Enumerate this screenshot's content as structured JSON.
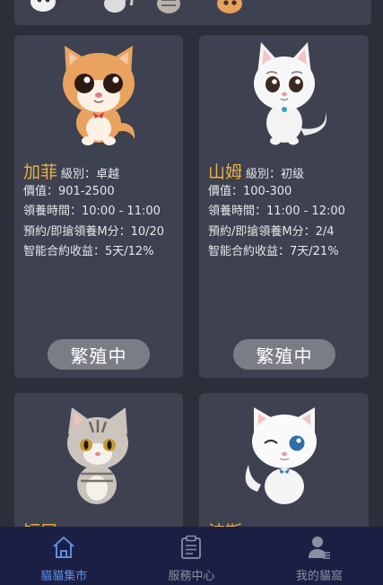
{
  "cats": [
    {
      "name": "加菲",
      "level": "級別：卓越",
      "price": "價值：901-2500",
      "adopt_time": "領養時間：10:00 - 11:00",
      "reserve": "預約/即搶領養M分：10/20",
      "contract": "智能合約收益：5天/12%",
      "status": "繁殖中"
    },
    {
      "name": "山姆",
      "level": "級別：初级",
      "price": "價值：100-300",
      "adopt_time": "領養時間：11:00 - 12:00",
      "reserve": "預約/即搶領養M分：2/4",
      "contract": "智能合約收益：7天/21%",
      "status": "繁殖中"
    }
  ],
  "partial_cats": [
    {
      "name": "短尾"
    },
    {
      "name": "波斯"
    }
  ],
  "tabs": [
    {
      "label": "貓貓集市",
      "icon": "home-icon",
      "active": true
    },
    {
      "label": "服務中心",
      "icon": "clipboard-icon",
      "active": false
    },
    {
      "label": "我的貓窩",
      "icon": "user-icon",
      "active": false
    }
  ],
  "colors": {
    "background": "#2c2f3a",
    "card": "#3e4150",
    "cat_name": "#e9b142",
    "button": "#7b7d86",
    "tabbar": "#1c1f44",
    "tab_active": "#5c8fe0",
    "tab_inactive": "#8c8ea2"
  }
}
